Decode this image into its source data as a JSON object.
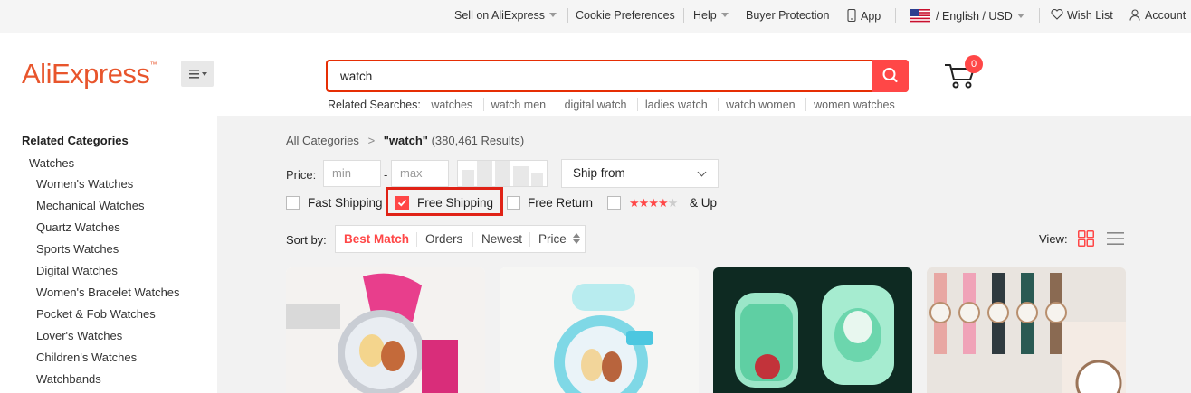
{
  "topbar": {
    "sell": "Sell on AliExpress",
    "cookie": "Cookie Preferences",
    "help": "Help",
    "buyer_protection": "Buyer Protection",
    "app": "App",
    "language_currency": "/ English /  USD",
    "wishlist": "Wish List",
    "account": "Account"
  },
  "header": {
    "logo_text": "AliExpress",
    "logo_tm": "™",
    "search_value": "watch",
    "cart_count": "0",
    "related_label": "Related Searches:",
    "related_items": [
      "watches",
      "watch men",
      "digital watch",
      "ladies watch",
      "watch women",
      "women watches"
    ]
  },
  "sidebar": {
    "title": "Related Categories",
    "main_category": "Watches",
    "items": [
      "Women's Watches",
      "Mechanical Watches",
      "Quartz Watches",
      "Sports Watches",
      "Digital Watches",
      "Women's Bracelet Watches",
      "Pocket & Fob Watches",
      "Lover's Watches",
      "Children's Watches",
      "Watchbands"
    ]
  },
  "breadcrumb": {
    "root": "All Categories",
    "sep": ">",
    "query": "\"watch\"",
    "results": "(380,461 Results)"
  },
  "filters": {
    "price_label": "Price:",
    "min_placeholder": "min",
    "max_placeholder": "max",
    "dash": "-",
    "ship_from": "Ship from",
    "fast_shipping": "Fast Shipping",
    "free_shipping": "Free Shipping",
    "free_shipping_checked": true,
    "free_return": "Free Return",
    "rating_stars_filled": 4,
    "rating_suffix": "& Up"
  },
  "sort": {
    "label": "Sort by:",
    "options": [
      "Best Match",
      "Orders",
      "Newest",
      "Price"
    ],
    "active": "Best Match",
    "view_label": "View:"
  },
  "colors": {
    "accent": "#ff4747",
    "brand": "#e8552c",
    "highlight": "#e02216"
  }
}
